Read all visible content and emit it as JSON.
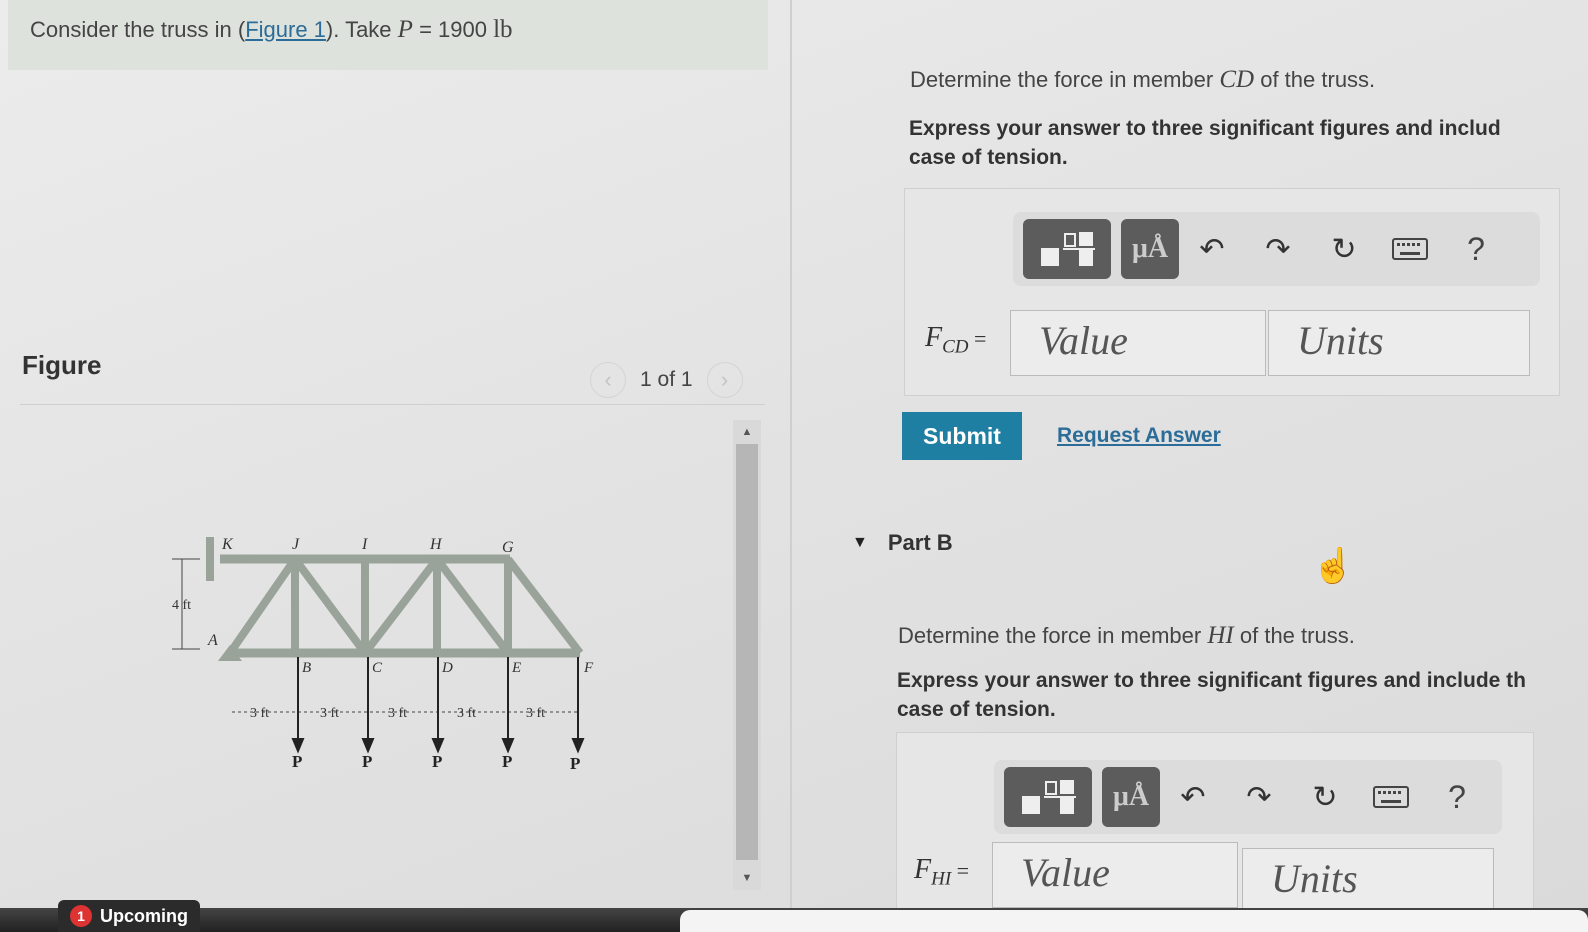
{
  "problem": {
    "prefix": "Consider the truss in (",
    "link": "Figure 1",
    "suffix": "). Take",
    "var": "P",
    "eq": " = 1900",
    "unit": "lb"
  },
  "figure": {
    "label": "Figure",
    "pager": "1 of 1",
    "prev_icon": "chevron-left-icon",
    "next_icon": "chevron-right-icon",
    "truss": {
      "top_nodes": [
        "K",
        "J",
        "I",
        "H",
        "G"
      ],
      "bottom_nodes": [
        "A",
        "B",
        "C",
        "D",
        "E",
        "F"
      ],
      "height_label": "4 ft",
      "span_labels": [
        "3 ft",
        "3 ft",
        "3 ft",
        "3 ft",
        "3 ft"
      ],
      "load_label": "P"
    }
  },
  "partA": {
    "question_prefix": "Determine the force in member",
    "member": "CD",
    "question_suffix": "of the truss.",
    "instruction_line1": "Express your answer to three significant figures and includ",
    "instruction_line2": "case of tension.",
    "var_main": "F",
    "var_sub": "CD",
    "var_eq": " =",
    "value_placeholder": "Value",
    "units_placeholder": "Units",
    "submit": "Submit",
    "request": "Request Answer"
  },
  "partB": {
    "title": "Part B",
    "question_prefix": "Determine the force in member",
    "member": "HI",
    "question_suffix": "of the truss.",
    "instruction_line1": "Express your answer to three significant figures and include th",
    "instruction_line2": "case of tension.",
    "var_main": "F",
    "var_sub": "HI",
    "var_eq": " =",
    "value_placeholder": "Value",
    "units_placeholder": "Units"
  },
  "toolbar": {
    "templates_icon": "templates-icon",
    "mu_label": "μÅ",
    "undo_icon": "undo-icon",
    "redo_icon": "redo-icon",
    "reset_icon": "reset-icon",
    "keyboard_icon": "keyboard-icon",
    "help_label": "?"
  },
  "taskbar": {
    "badge": "1",
    "label": "Upcoming"
  },
  "colors": {
    "accent": "#1f7fa3",
    "link": "#2b6c98",
    "problem_bg": "#dde2dd"
  }
}
